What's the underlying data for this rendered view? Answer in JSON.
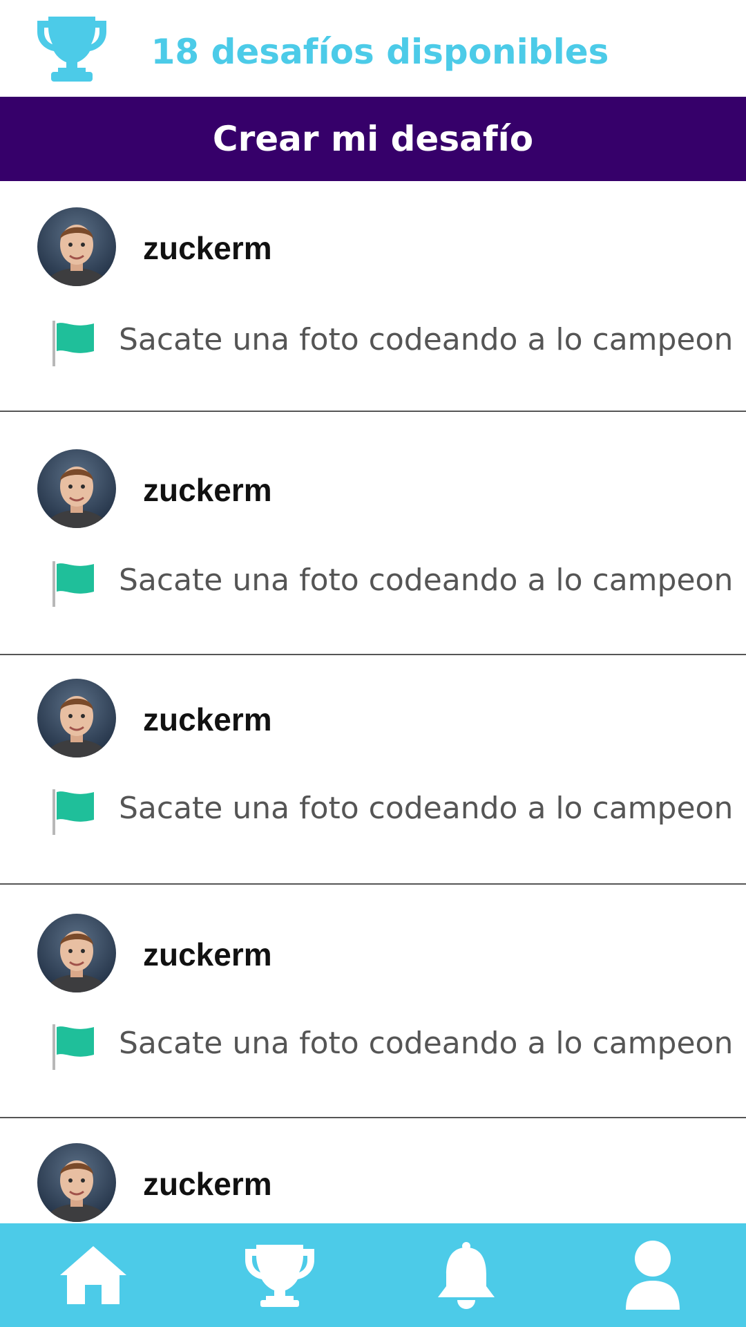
{
  "colors": {
    "accent": "#4ccbe8",
    "banner": "#36006a",
    "flag": "#1fbf9a",
    "text_secondary": "#555555"
  },
  "header": {
    "icon": "trophy-icon",
    "title": "18 desafíos disponibles"
  },
  "create_button": {
    "label": "Crear mi desafío"
  },
  "feed": {
    "items": [
      {
        "username": "zuckerm",
        "challenge": "Sacate una foto codeando a lo campeon",
        "icon": "flag-icon"
      },
      {
        "username": "zuckerm",
        "challenge": "Sacate una foto codeando a lo campeon",
        "icon": "flag-icon"
      },
      {
        "username": "zuckerm",
        "challenge": "Sacate una foto codeando a lo campeon",
        "icon": "flag-icon"
      },
      {
        "username": "zuckerm",
        "challenge": "Sacate una foto codeando a lo campeon",
        "icon": "flag-icon"
      },
      {
        "username": "zuckerm"
      }
    ]
  },
  "tabbar": {
    "tabs": [
      {
        "icon": "home-icon"
      },
      {
        "icon": "trophy-icon"
      },
      {
        "icon": "bell-icon"
      },
      {
        "icon": "user-icon"
      }
    ]
  }
}
